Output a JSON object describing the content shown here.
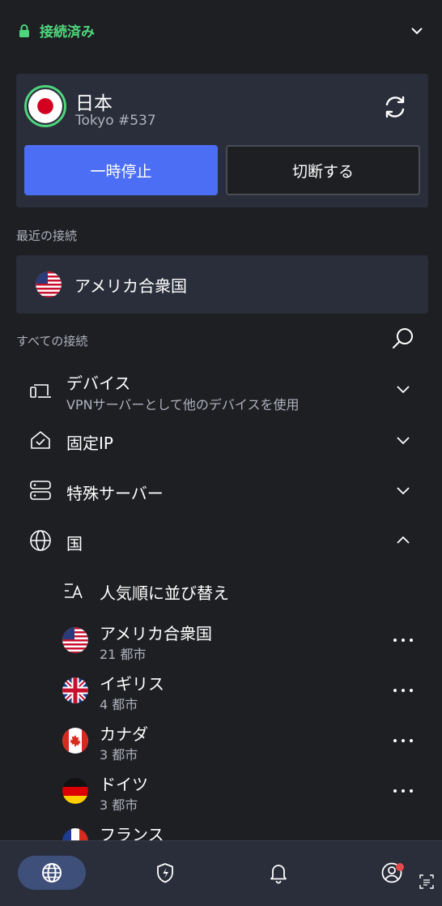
{
  "status": {
    "text": "接続済み",
    "icon": "lock-icon",
    "color": "#4ed67c"
  },
  "connection": {
    "country": "日本",
    "server": "Tokyo #537",
    "pause_label": "一時停止",
    "disconnect_label": "切断する"
  },
  "recent": {
    "label": "最近の接続",
    "items": [
      {
        "name": "アメリカ合衆国",
        "flag": "us"
      }
    ]
  },
  "all": {
    "label": "すべての接続"
  },
  "categories": [
    {
      "title": "デバイス",
      "subtitle": "VPNサーバーとして他のデバイスを使用",
      "icon": "devices-icon",
      "expanded": false
    },
    {
      "title": "固定IP",
      "icon": "home-check-icon",
      "expanded": false
    },
    {
      "title": "特殊サーバー",
      "icon": "servers-icon",
      "expanded": false
    },
    {
      "title": "国",
      "icon": "globe-icon",
      "expanded": true
    }
  ],
  "sort": {
    "label": "人気順に並び替え"
  },
  "countries": [
    {
      "name": "アメリカ合衆国",
      "cities": "21 都市",
      "flag": "us"
    },
    {
      "name": "イギリス",
      "cities": "4 都市",
      "flag": "gb"
    },
    {
      "name": "カナダ",
      "cities": "3 都市",
      "flag": "ca"
    },
    {
      "name": "ドイツ",
      "cities": "3 都市",
      "flag": "de"
    },
    {
      "name": "フランス",
      "cities": "",
      "flag": "fr"
    }
  ],
  "nav": {
    "items": [
      "globe-icon",
      "shield-bolt-icon",
      "bell-icon",
      "profile-icon"
    ],
    "active": 0,
    "badge_color": "#e5484d"
  },
  "colors": {
    "accent": "#4c6ef5",
    "connected": "#4ed67c",
    "background": "#1e1f23",
    "card": "#2a2e3a"
  }
}
